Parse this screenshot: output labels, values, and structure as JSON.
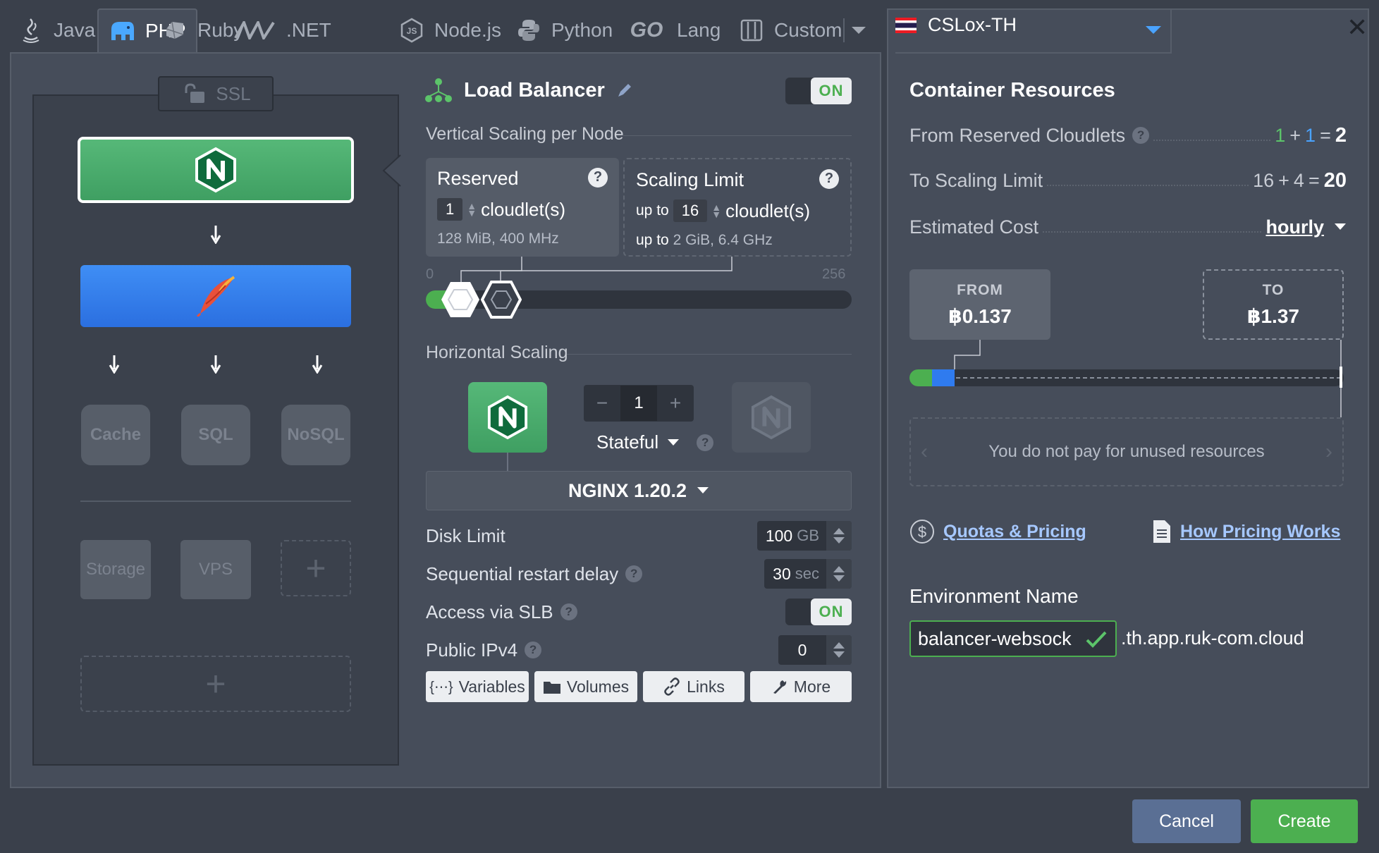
{
  "tabs": [
    {
      "label": "Java",
      "icon": "java-icon"
    },
    {
      "label": "PHP",
      "icon": "php-elephant-icon",
      "active": true
    },
    {
      "label": "Ruby",
      "icon": "ruby-icon"
    },
    {
      "label": ".NET",
      "icon": "dotnet-icon"
    },
    {
      "label": "Node.js",
      "icon": "nodejs-icon"
    },
    {
      "label": "Python",
      "icon": "python-icon"
    },
    {
      "label": "Lang",
      "icon": "go-icon",
      "icon_text": "GO"
    },
    {
      "label": "Custom",
      "icon": "custom-icon"
    }
  ],
  "region": {
    "name": "CSLox-TH",
    "flag": "thailand-flag-icon"
  },
  "topology": {
    "ssl_label": "SSL",
    "databases": [
      "Cache",
      "SQL",
      "NoSQL"
    ],
    "storage_label": "Storage",
    "vps_label": "VPS",
    "add_symbol": "+"
  },
  "node": {
    "title": "Load Balancer",
    "toggle_label": "ON"
  },
  "vertical": {
    "section_label": "Vertical Scaling per Node",
    "reserved": {
      "title": "Reserved",
      "value": "1",
      "unit": "cloudlet(s)",
      "spec": "128 MiB, 400 MHz"
    },
    "limit": {
      "title": "Scaling Limit",
      "prefix": "up to",
      "value": "16",
      "unit": "cloudlet(s)",
      "spec_prefix": "up to",
      "spec": "2 GiB, 6.4 GHz"
    },
    "slider_min": "0",
    "slider_max": "256"
  },
  "horizontal": {
    "section_label": "Horizontal Scaling",
    "count": "1",
    "minus": "−",
    "plus": "+",
    "mode": "Stateful",
    "version": "NGINX 1.20.2"
  },
  "fields": {
    "disk_limit": {
      "label": "Disk Limit",
      "value": "100",
      "unit": "GB"
    },
    "restart_delay": {
      "label": "Sequential restart delay",
      "value": "30",
      "unit": "sec"
    },
    "slb": {
      "label": "Access via SLB",
      "toggle": "ON"
    },
    "ipv4": {
      "label": "Public IPv4",
      "value": "0"
    }
  },
  "tool_buttons": {
    "variables": "Variables",
    "volumes": "Volumes",
    "links": "Links",
    "more": "More"
  },
  "resources": {
    "title": "Container Resources",
    "reserved_label": "From Reserved Cloudlets",
    "reserved_a": "1",
    "reserved_b": "1",
    "reserved_total": "2",
    "limit_label": "To Scaling Limit",
    "limit_a": "16",
    "limit_b": "4",
    "limit_total": "20",
    "plus": "+",
    "equals": "=",
    "cost_label": "Estimated Cost",
    "cost_period": "hourly",
    "from_label": "FROM",
    "from_value": "฿0.137",
    "to_label": "TO",
    "to_value": "฿1.37",
    "unused_note": "You do not pay for unused resources",
    "quotas_link": "Quotas & Pricing",
    "pricing_link": "How Pricing Works"
  },
  "environment": {
    "label": "Environment Name",
    "value": "balancer-websock",
    "suffix": ".th.app.ruk-com.cloud"
  },
  "footer": {
    "cancel": "Cancel",
    "create": "Create"
  },
  "colors": {
    "accent_green": "#4caf50",
    "accent_blue": "#2f7bef",
    "link": "#a6c8ff",
    "panel": "#464d5a"
  }
}
